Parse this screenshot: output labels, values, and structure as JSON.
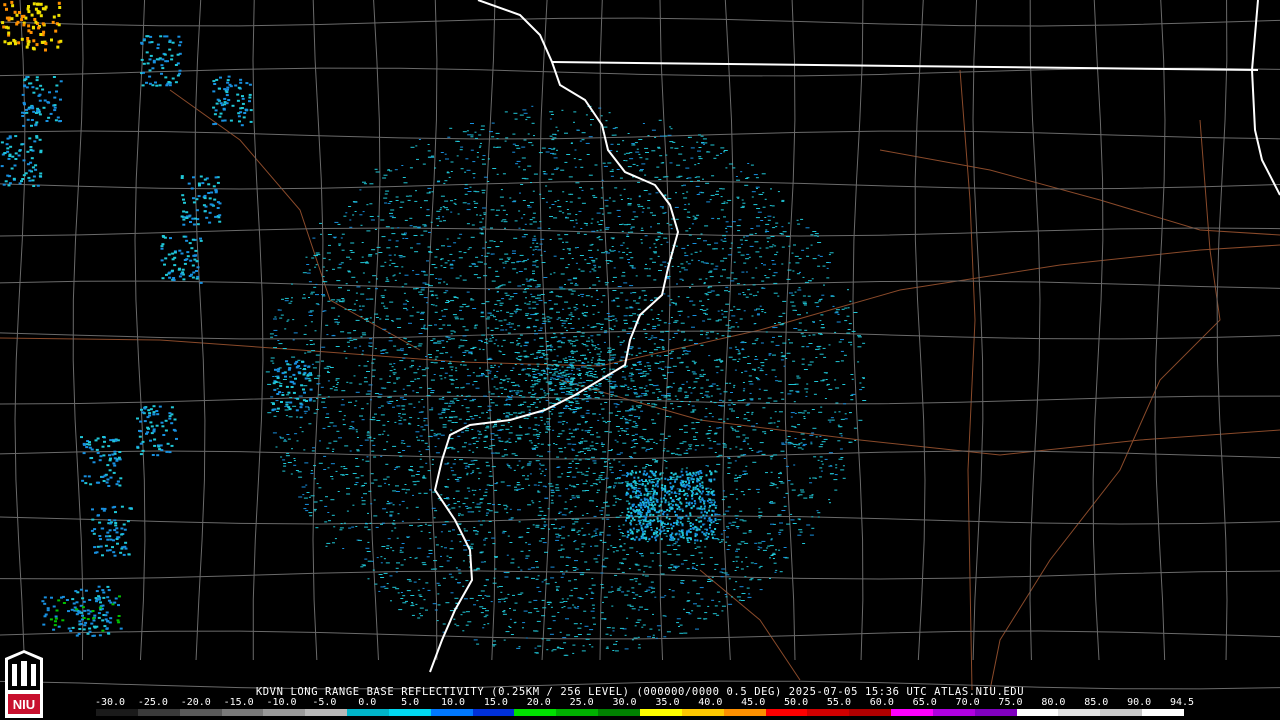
{
  "product": {
    "caption": "KDVN LONG RANGE BASE REFLECTIVITY (0.25KM / 256 LEVEL) (000000/0000 0.5 DEG) 2025-07-05 15:36 UTC  ATLAS.NIU.EDU"
  },
  "logo": {
    "text": "NIU"
  },
  "color_scale": {
    "labels": [
      "-30.0",
      "-25.0",
      "-20.0",
      "-15.0",
      "-10.0",
      "-5.0",
      "0.0",
      "5.0",
      "10.0",
      "15.0",
      "20.0",
      "25.0",
      "30.0",
      "35.0",
      "40.0",
      "45.0",
      "50.0",
      "55.0",
      "60.0",
      "65.0",
      "70.0",
      "75.0",
      "80.0",
      "85.0",
      "90.0",
      "94.5"
    ],
    "colors": [
      "#1a1a1a",
      "#3a3a3a",
      "#5a5a5a",
      "#7a7a7a",
      "#9a9a9a",
      "#b8b8b8",
      "#00b4c8",
      "#00d7f0",
      "#0078ff",
      "#0030d8",
      "#00e000",
      "#00b000",
      "#008000",
      "#ffff00",
      "#ffc800",
      "#ff9000",
      "#ff0000",
      "#d00000",
      "#b00000",
      "#ff00ff",
      "#b000e0",
      "#8000c0",
      "#ffffff",
      "#e0e0e0",
      "#c8c8c8",
      "#ffffff"
    ]
  },
  "colors": {
    "background": "#000000",
    "county_lines": "#6a6a6a",
    "state_lines": "#ffffff",
    "roads": "#8a4a2a",
    "echo_light": "#20c8d8",
    "echo_mid": "#1890e0",
    "echo_heavy": "#f0e000"
  }
}
